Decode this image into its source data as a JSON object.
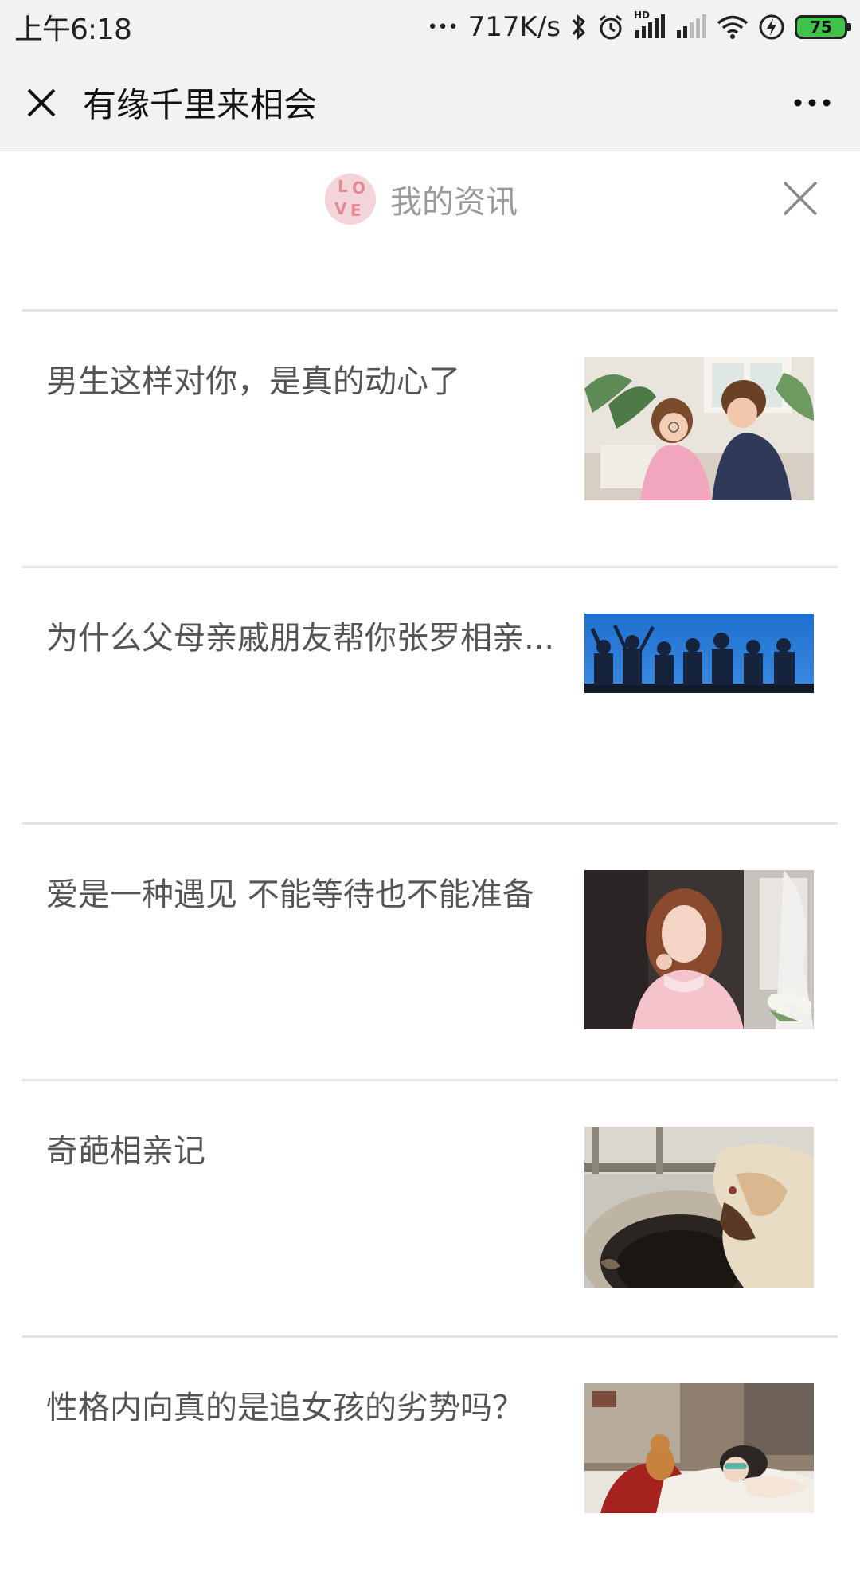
{
  "status_bar": {
    "time": "上午6:18",
    "dots": "•••",
    "net_speed": "717K/s",
    "signal_label": "HD",
    "battery_level": "75"
  },
  "title_bar": {
    "title": "有缘千里来相会",
    "close_icon": "close-icon",
    "more_icon": "more-icon"
  },
  "sub_header": {
    "title": "我的资讯",
    "logo_letters": [
      "L",
      "O",
      "V",
      "E"
    ]
  },
  "articles": [
    {
      "title": "男生这样对你，是真的动心了"
    },
    {
      "title": "为什么父母亲戚朋友帮你张罗相亲..."
    },
    {
      "title": "爱是一种遇见 不能等待也不能准备"
    },
    {
      "title": "奇葩相亲记"
    },
    {
      "title": "性格内向真的是追女孩的劣势吗？"
    }
  ],
  "colors": {
    "bar_background": "#f2f2f2",
    "divider": "#e4e4e4",
    "article_text": "#555555",
    "battery_green": "#3fc34a"
  }
}
